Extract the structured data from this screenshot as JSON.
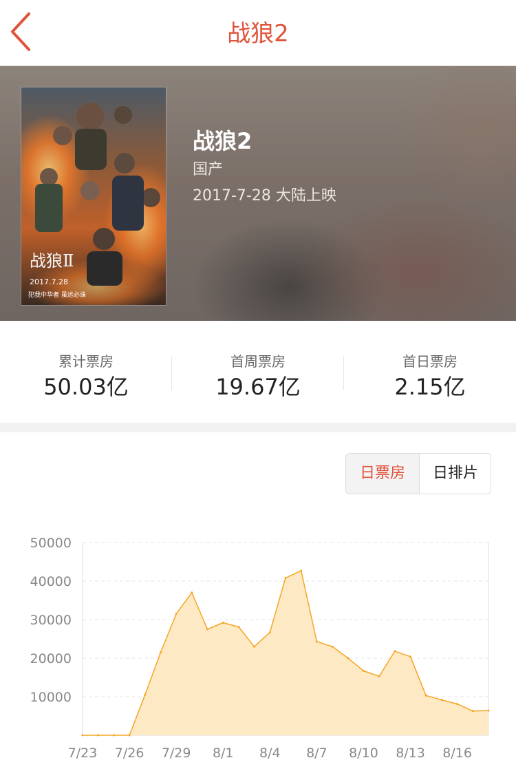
{
  "header": {
    "title": "战狼2",
    "back_icon": "chevron-left-icon",
    "accent_color": "#e0533a"
  },
  "movie": {
    "title": "战狼2",
    "origin": "国产",
    "release": "2017-7-28 大陆上映",
    "poster": {
      "title_text": "战狼Ⅱ",
      "date_text": "2017.7.28",
      "slogan": "犯我中华者 虽远必诛"
    }
  },
  "stats": [
    {
      "label": "累计票房",
      "value": "50.03亿"
    },
    {
      "label": "首周票房",
      "value": "19.67亿"
    },
    {
      "label": "首日票房",
      "value": "2.15亿"
    }
  ],
  "toggle": {
    "daily_box_office": "日票房",
    "daily_schedule": "日排片",
    "selected": "日票房"
  },
  "chart_data": {
    "type": "area",
    "title": "",
    "xlabel": "",
    "ylabel": "",
    "ylim": [
      0,
      50000
    ],
    "yticks": [
      10000,
      20000,
      30000,
      40000,
      50000
    ],
    "xticks": [
      "7/23",
      "7/26",
      "7/29",
      "8/1",
      "8/4",
      "8/7",
      "8/10",
      "8/13",
      "8/16"
    ],
    "grid": true,
    "line_color": "#f5a623",
    "fill_color": "#fde9c4",
    "x": [
      "7/23",
      "7/24",
      "7/25",
      "7/26",
      "7/27",
      "7/28",
      "7/29",
      "7/30",
      "7/31",
      "8/1",
      "8/2",
      "8/3",
      "8/4",
      "8/5",
      "8/6",
      "8/7",
      "8/8",
      "8/9",
      "8/10",
      "8/11",
      "8/12",
      "8/13",
      "8/14",
      "8/15",
      "8/16",
      "8/17",
      "8/18"
    ],
    "series": [
      {
        "values": [
          0,
          0,
          0,
          0,
          10500,
          21500,
          31500,
          37000,
          27500,
          29200,
          28100,
          23000,
          26700,
          40800,
          42700,
          24300,
          23000,
          20000,
          16700,
          15300,
          21800,
          20400,
          10300,
          9200,
          8100,
          6300,
          6400
        ]
      }
    ]
  }
}
